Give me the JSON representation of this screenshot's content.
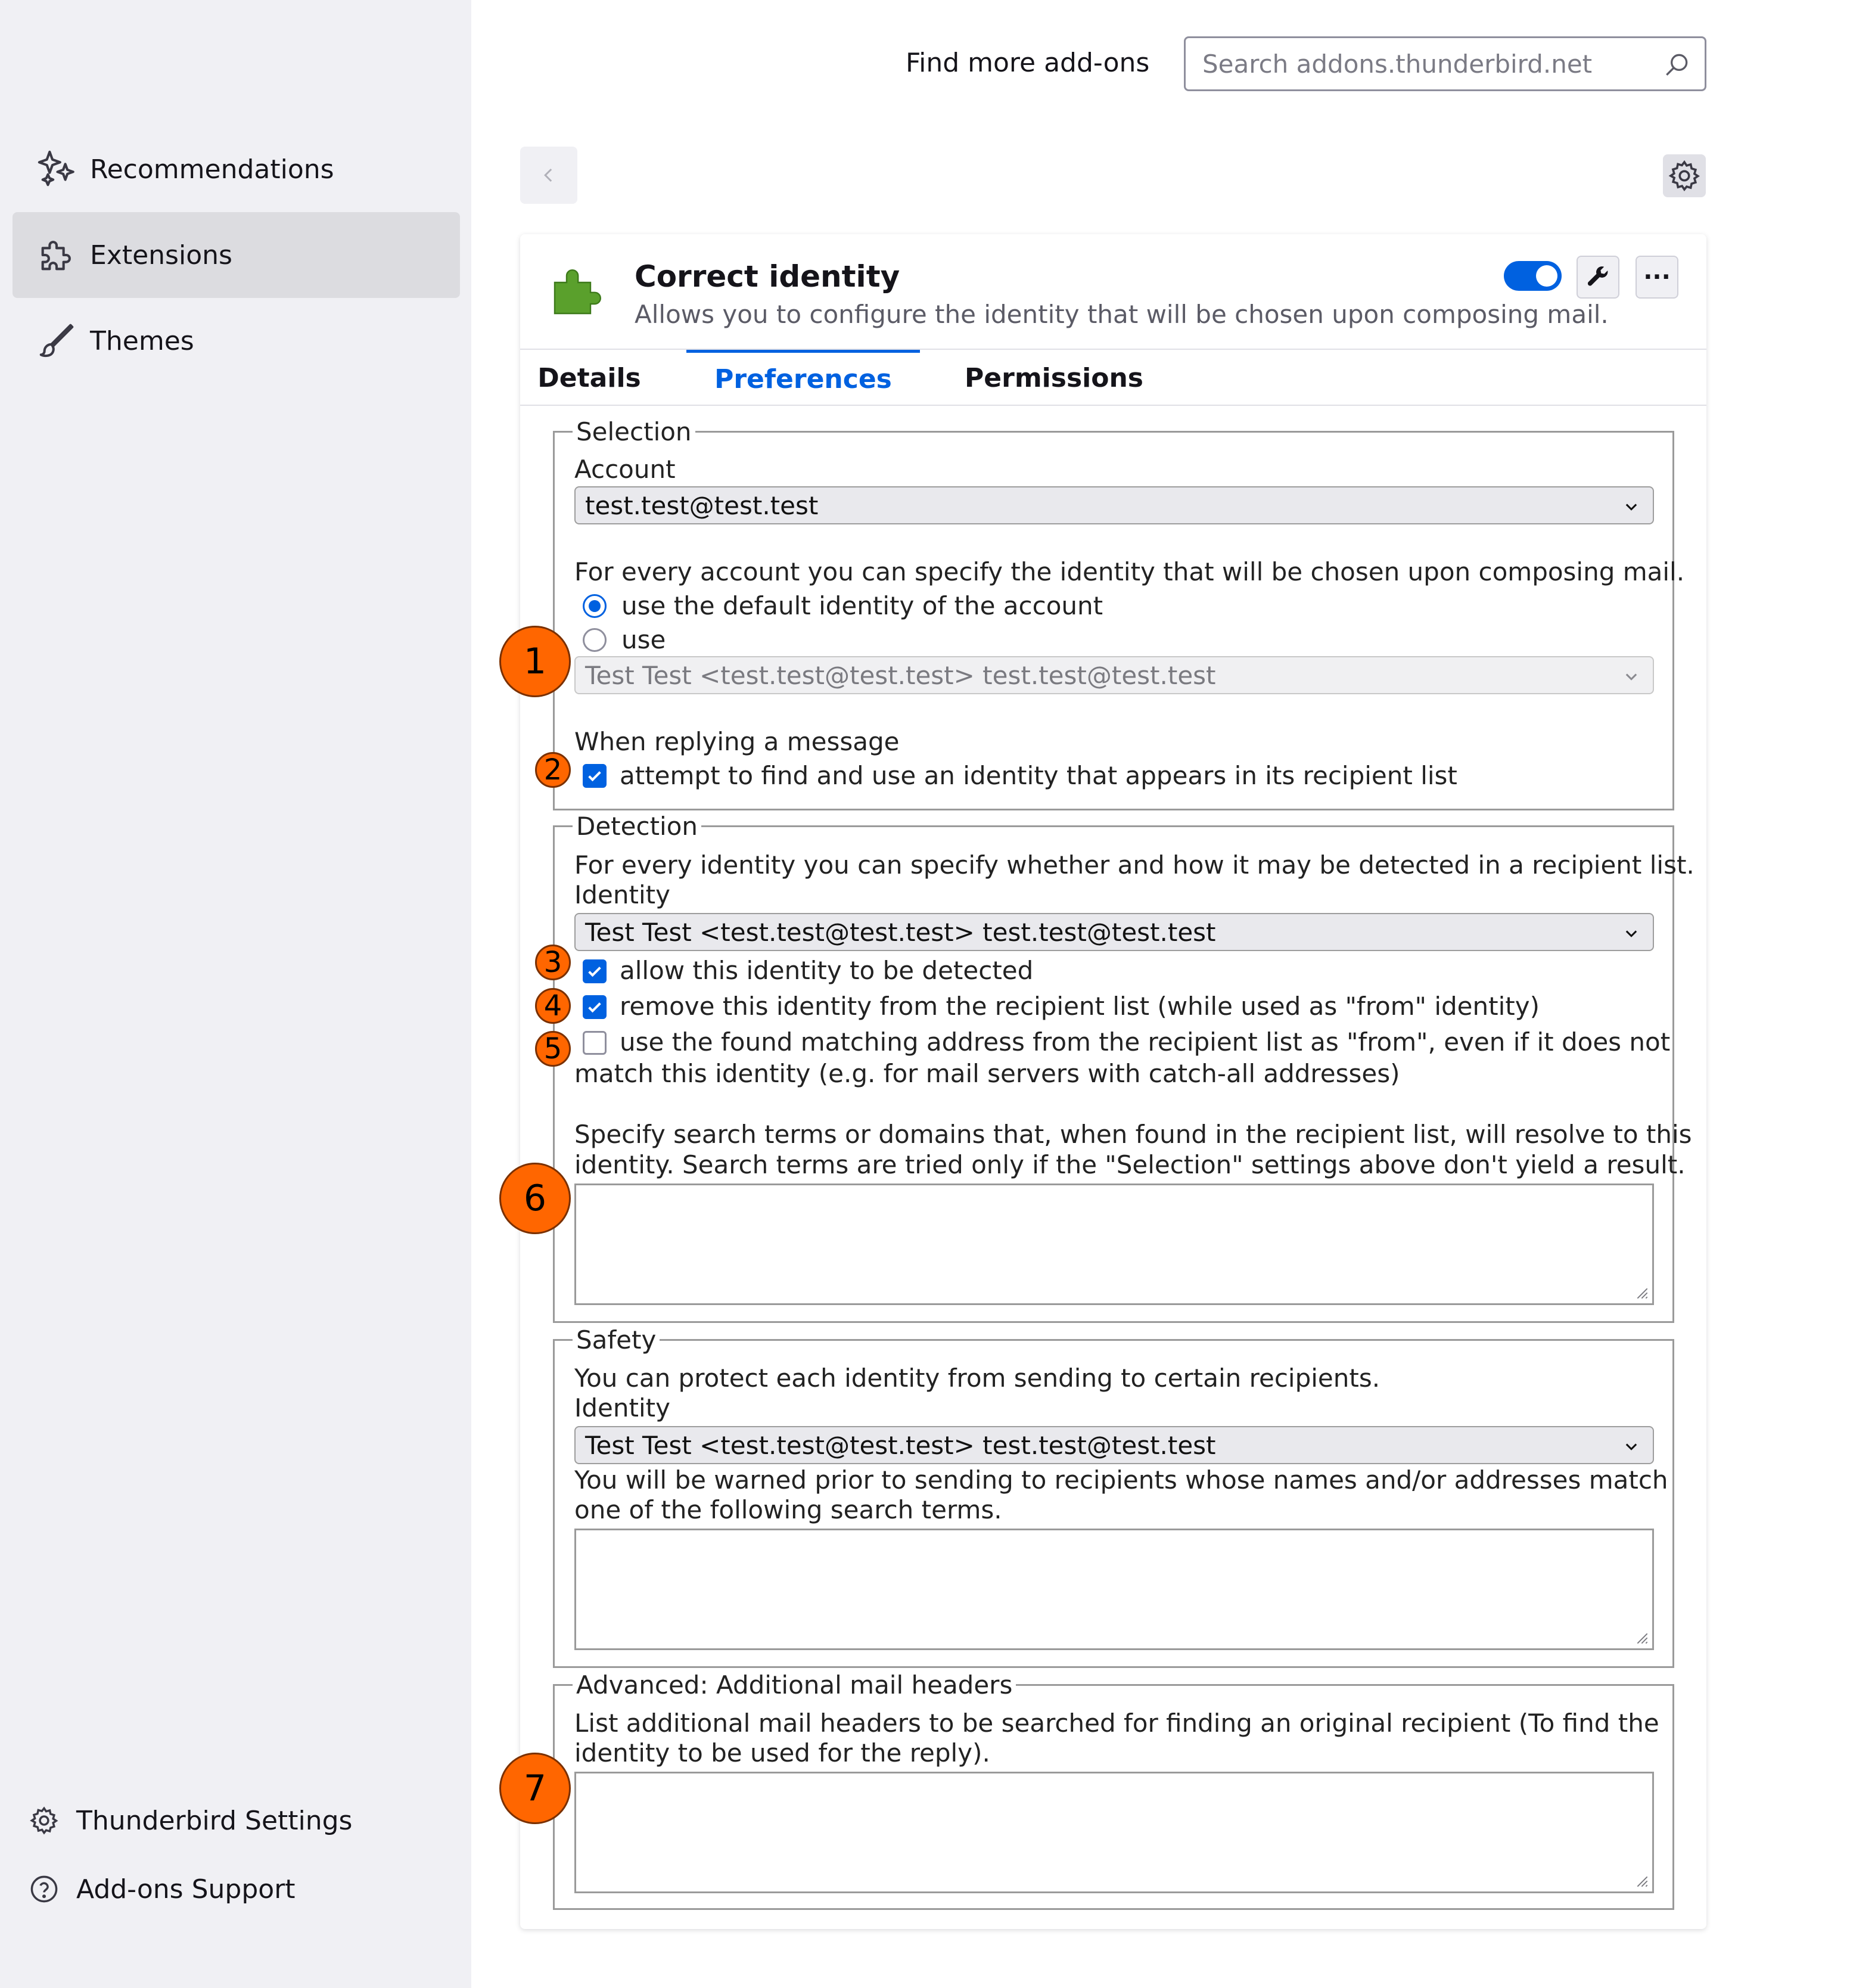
{
  "sidebar": {
    "categories": [
      {
        "label": "Recommendations",
        "icon": "sparkle-icon"
      },
      {
        "label": "Extensions",
        "icon": "puzzle-icon"
      },
      {
        "label": "Themes",
        "icon": "brush-icon"
      }
    ],
    "footer": [
      {
        "label": "Thunderbird Settings",
        "icon": "gear-icon"
      },
      {
        "label": "Add-ons Support",
        "icon": "help-icon"
      }
    ]
  },
  "header": {
    "find_label": "Find more add-ons",
    "search_placeholder": "Search addons.thunderbird.net"
  },
  "addon": {
    "name": "Correct identity",
    "description": "Allows you to configure the identity that will be chosen upon composing mail.",
    "enabled": true,
    "more_label": "···",
    "tabs": [
      "Details",
      "Preferences",
      "Permissions"
    ],
    "active_tab": "Preferences"
  },
  "options": {
    "selection": {
      "legend": "Selection",
      "account_label": "Account",
      "account_value": "test.test@test.test",
      "intro": "For every account you can specify the identity that will be chosen upon composing mail.",
      "radio_default": "use the default identity of the account",
      "radio_use": "use",
      "identity_value": "Test Test <test.test@test.test> test.test@test.test",
      "replying_label": "When replying a message",
      "reply_check": "attempt to find and use an identity that appears in its recipient list"
    },
    "detection": {
      "legend": "Detection",
      "intro": "For every identity you can specify whether and how it may be detected in a recipient list.",
      "identity_label": "Identity",
      "identity_value": "Test Test <test.test@test.test> test.test@test.test",
      "check_allow": "allow this identity to be detected",
      "check_remove": "remove this identity from the recipient list (while used as \"from\" identity)",
      "check_found_1": "use the found matching address from the recipient list as \"from\", even if it does not",
      "check_found_2": "match this identity (e.g. for mail servers with catch-all addresses)",
      "search_desc_1": "Specify search terms or domains that, when found in the recipient list, will resolve to this",
      "search_desc_2": "identity. Search terms are tried only if the \"Selection\" settings above don't yield a result."
    },
    "safety": {
      "legend": "Safety",
      "intro": "You can protect each identity from sending to certain recipients.",
      "identity_label": "Identity",
      "identity_value": "Test Test <test.test@test.test> test.test@test.test",
      "warn_1": "You will be warned prior to sending to recipients whose names and/or addresses match",
      "warn_2": "one of the following search terms."
    },
    "advanced": {
      "legend": "Advanced: Additional mail headers",
      "desc_1": "List additional mail headers to be searched for finding an original recipient (To find the",
      "desc_2": "identity to be used for the reply)."
    }
  },
  "callouts": [
    "1",
    "2",
    "3",
    "4",
    "5",
    "6",
    "7"
  ],
  "colors": {
    "accent": "#0061e0",
    "callout": "#ff6600",
    "sidebar_bg": "#f0f0f4"
  }
}
